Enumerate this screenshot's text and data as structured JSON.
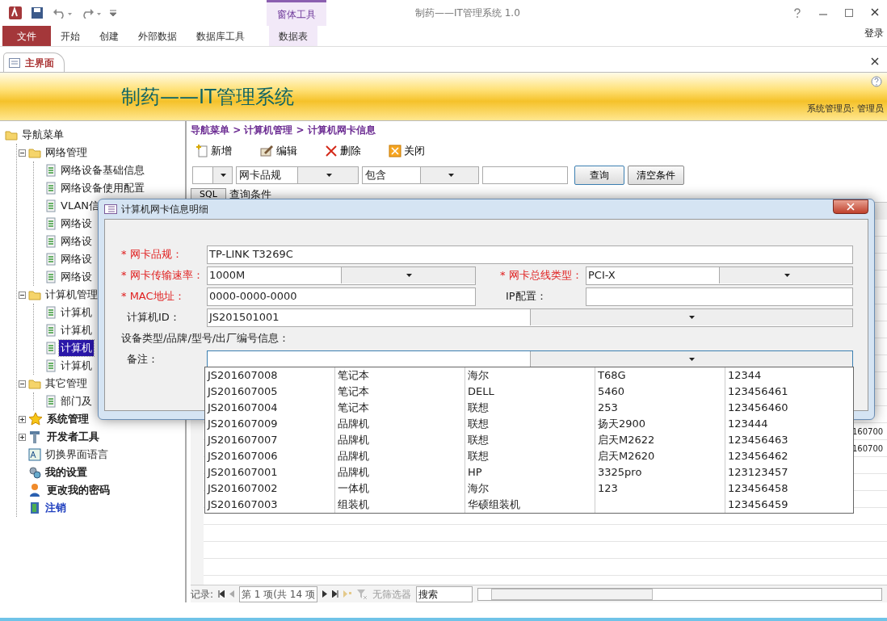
{
  "title_bar": {
    "title": "制药——IT管理系统 1.0",
    "context_tab": "窗体工具"
  },
  "ribbon": {
    "tabs": [
      {
        "label": "文件",
        "kind": "file",
        "selected": false
      },
      {
        "label": "开始",
        "kind": "plain",
        "selected": false
      },
      {
        "label": "创建",
        "kind": "plain",
        "selected": false
      },
      {
        "label": "外部数据",
        "kind": "plain",
        "selected": false
      },
      {
        "label": "数据库工具",
        "kind": "plain",
        "selected": false
      },
      {
        "label": "数据表",
        "kind": "context",
        "selected": false
      }
    ],
    "account": "登录"
  },
  "document_tabs": [
    {
      "label": "主界面",
      "selected": true
    }
  ],
  "banner": {
    "title": "制药——IT管理系统",
    "user": "系统管理员: 管理员"
  },
  "nav_tree": {
    "label": "导航菜单",
    "kind": "folder",
    "selected": false,
    "children": [
      {
        "label": "网络管理",
        "kind": "folder",
        "expanded": true,
        "selected": false,
        "children": [
          {
            "label": "网络设备基础信息",
            "kind": "page",
            "selected": false
          },
          {
            "label": "网络设备使用配置",
            "kind": "page",
            "selected": false
          },
          {
            "label": "VLAN信",
            "kind": "page",
            "selected": false
          },
          {
            "label": "网络设",
            "kind": "page",
            "selected": false
          },
          {
            "label": "网络设",
            "kind": "page",
            "selected": false
          },
          {
            "label": "网络设",
            "kind": "page",
            "selected": false
          },
          {
            "label": "网络设",
            "kind": "page",
            "selected": false
          }
        ]
      },
      {
        "label": "计算机管理",
        "kind": "folder",
        "expanded": true,
        "selected": false,
        "children": [
          {
            "label": "计算机",
            "kind": "page",
            "selected": false
          },
          {
            "label": "计算机",
            "kind": "page",
            "selected": false
          },
          {
            "label": "计算机",
            "kind": "page",
            "selected": true
          },
          {
            "label": "计算机",
            "kind": "page",
            "selected": false
          }
        ]
      },
      {
        "label": "其它管理",
        "kind": "folder",
        "expanded": true,
        "selected": false,
        "children": [
          {
            "label": "部门及",
            "kind": "page",
            "selected": false
          }
        ]
      },
      {
        "label": "系统管理",
        "kind": "star",
        "expanded": false,
        "bold": true,
        "selected": false
      },
      {
        "label": "开发者工具",
        "kind": "tools",
        "expanded": false,
        "bold": true,
        "selected": false
      },
      {
        "label": "切换界面语言",
        "kind": "language",
        "bold": false,
        "selected": false
      },
      {
        "label": "我的设置",
        "kind": "settings",
        "bold": true,
        "selected": false
      },
      {
        "label": "更改我的密码",
        "kind": "user",
        "bold": true,
        "selected": false
      },
      {
        "label": "注销",
        "kind": "logout",
        "bold": true,
        "color": "#1f3fbf",
        "selected": false
      }
    ]
  },
  "breadcrumb": "导航菜单 > 计算机管理 > 计算机网卡信息",
  "toolbar": [
    {
      "label": "新增",
      "kind": "new"
    },
    {
      "label": "编辑",
      "kind": "edit"
    },
    {
      "label": "删除",
      "kind": "delete"
    },
    {
      "label": "关闭",
      "kind": "close"
    }
  ],
  "filter": {
    "field": "网卡品规",
    "operator": "包含",
    "buttons": [
      "查询",
      "清空条件"
    ]
  },
  "sql_button": "SQL",
  "query_label": "查询条件",
  "grid": {
    "column_7_cells": [
      "160700",
      "160700"
    ]
  },
  "record_nav": {
    "label": "记录:",
    "position": "第 1 项(共 14 项",
    "filter": "无筛选器",
    "search": "搜索"
  },
  "dialog": {
    "title": "计算机网卡信息明细",
    "fields": [
      {
        "label": "* 网卡品规：",
        "value": "TP-LINK T3269C",
        "required": true,
        "kind": "text"
      },
      {
        "label": "* 网卡传输速率：",
        "value": "1000M",
        "required": true,
        "kind": "combo"
      },
      {
        "label": "* 网卡总线类型：",
        "value": "PCI-X",
        "required": true,
        "kind": "combo"
      },
      {
        "label": "* MAC地址：",
        "value": "0000-0000-0000",
        "required": true,
        "kind": "text"
      },
      {
        "label": "IP配置：",
        "required": false,
        "kind": "text"
      },
      {
        "label": "计算机ID：",
        "value": "JS201501001",
        "required": false,
        "kind": "combo"
      },
      {
        "label": "设备类型/品牌/型号/出厂编号信息：",
        "required": false,
        "kind": "heading"
      },
      {
        "label": "备注：",
        "required": false,
        "kind": "combo",
        "expanded": true
      }
    ],
    "dropdown_rows": [
      [
        "JS201607008",
        "笔记本",
        "海尔",
        "T68G",
        "12344"
      ],
      [
        "JS201607005",
        "笔记本",
        "DELL",
        "5460",
        "123456461"
      ],
      [
        "JS201607004",
        "笔记本",
        "联想",
        "253",
        "123456460"
      ],
      [
        "JS201607009",
        "品牌机",
        "联想",
        "扬天2900",
        "123444"
      ],
      [
        "JS201607007",
        "品牌机",
        "联想",
        "启天M2622",
        "123456463"
      ],
      [
        "JS201607006",
        "品牌机",
        "联想",
        "启天M2620",
        "123456462"
      ],
      [
        "JS201607001",
        "品牌机",
        "HP",
        "3325pro",
        "123123457"
      ],
      [
        "JS201607002",
        "一体机",
        "海尔",
        "123",
        "123456458"
      ],
      [
        "JS201607003",
        "组装机",
        "华硕组装机",
        "",
        "123456459"
      ]
    ]
  }
}
